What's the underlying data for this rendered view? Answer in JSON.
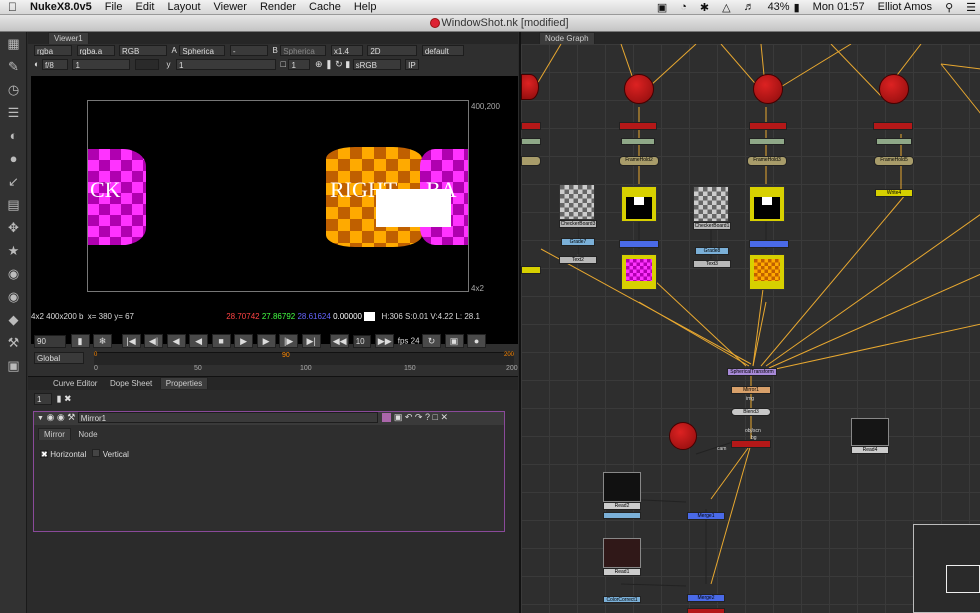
{
  "menubar": {
    "app": "NukeX8.0v5",
    "items": [
      "File",
      "Edit",
      "Layout",
      "Viewer",
      "Render",
      "Cache",
      "Help"
    ],
    "battery": "43%",
    "clock": "Mon 01:57",
    "user": "Elliot Amos"
  },
  "window": {
    "title": "WindowShot.nk [modified]"
  },
  "viewer": {
    "tab": "Viewer1",
    "channels": "rgba",
    "alpha": "rgba.a",
    "colorspace": "RGB",
    "a_input": "A",
    "spherical": "Spherica",
    "dash": "-",
    "b_input": "B",
    "b_spherical": "Spherica",
    "zoom": "x1.4",
    "mode": "2D",
    "lut": "default",
    "fstop": "f/8",
    "gain": "1",
    "gamma_label": "y",
    "gamma": "1",
    "proxy": "1",
    "display": "sRGB",
    "ip": "IP",
    "format_label": "400,200",
    "corner_label": "4x2",
    "texture_text_left": "CK",
    "texture_text_right": "RIGHT",
    "texture_text_back": "BA"
  },
  "infobar": {
    "format": "4x2 400x200 b",
    "coords": "x= 380 y= 67",
    "r": "28.70742",
    "g": "27.86792",
    "b": "28.61624",
    "a": "0.00000",
    "hsv": "H:306 S:0.01 V:4.22",
    "l": "L: 28.1"
  },
  "timeline": {
    "frame": "90",
    "step": "10",
    "fps": "fps 24",
    "mode": "Global",
    "start": "0",
    "current": "90",
    "ticks": [
      "0",
      "50",
      "100",
      "150",
      "200"
    ],
    "end": "200"
  },
  "properties": {
    "tabs": [
      "Curve Editor",
      "Dope Sheet",
      "Properties"
    ],
    "count": "1",
    "node_name": "Mirror1",
    "subtabs": [
      "Mirror",
      "Node"
    ],
    "horizontal": "Horizontal",
    "vertical": "Vertical"
  },
  "nodegraph": {
    "tab": "Node Graph",
    "nodes": {
      "camera": "Camera",
      "checker1": "CheckerBoard3",
      "checker2": "CheckerBoard1",
      "grade1": "Grade7",
      "grade2": "Grade8",
      "text1": "Text2",
      "text2": "Text3",
      "write1": "Write4",
      "write2": "Write5",
      "write3": "Write7",
      "write4": "Write8",
      "spherical": "SphericalTransform",
      "mirror": "Mirror1",
      "blend": "Blend3",
      "scanline": "ScanlineRender",
      "read1": "Read2",
      "read2": "Read1",
      "read3": "Read4",
      "merge1": "Merge1",
      "merge2": "Merge2",
      "colorcorrect": "ColorCorrect1",
      "obj": "obj/scn",
      "cam": "cam",
      "bg": "bg",
      "img": "img",
      "frame1": "FrameHold2",
      "frame2": "FrameHold3",
      "frame3": "FrameHold5"
    }
  },
  "colors": {
    "menubar": "#e0e0e0",
    "panel": "#2b2b2b",
    "accent": "#f0a020",
    "node_red": "#c01818",
    "write_yellow": "#d7d000"
  }
}
